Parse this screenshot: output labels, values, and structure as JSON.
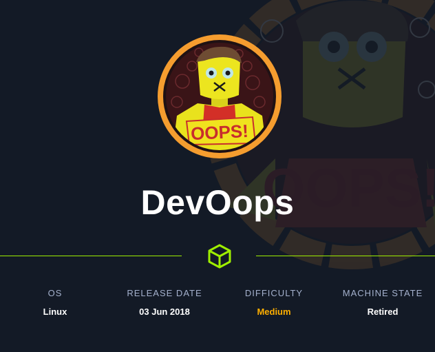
{
  "machine": {
    "name": "DevOops",
    "logo_text": "OOPS!"
  },
  "info": [
    {
      "label": "OS",
      "value": "Linux"
    },
    {
      "label": "RELEASE DATE",
      "value": "03 Jun 2018"
    },
    {
      "label": "DIFFICULTY",
      "value": "Medium"
    },
    {
      "label": "MACHINE STATE",
      "value": "Retired"
    }
  ],
  "colors": {
    "background": "#131a26",
    "accent": "#9fef00",
    "difficulty_medium": "#ffaf00",
    "label": "#a4b1cd",
    "ring": "#f59d2f"
  },
  "icons": {
    "divider": "cube-icon"
  }
}
